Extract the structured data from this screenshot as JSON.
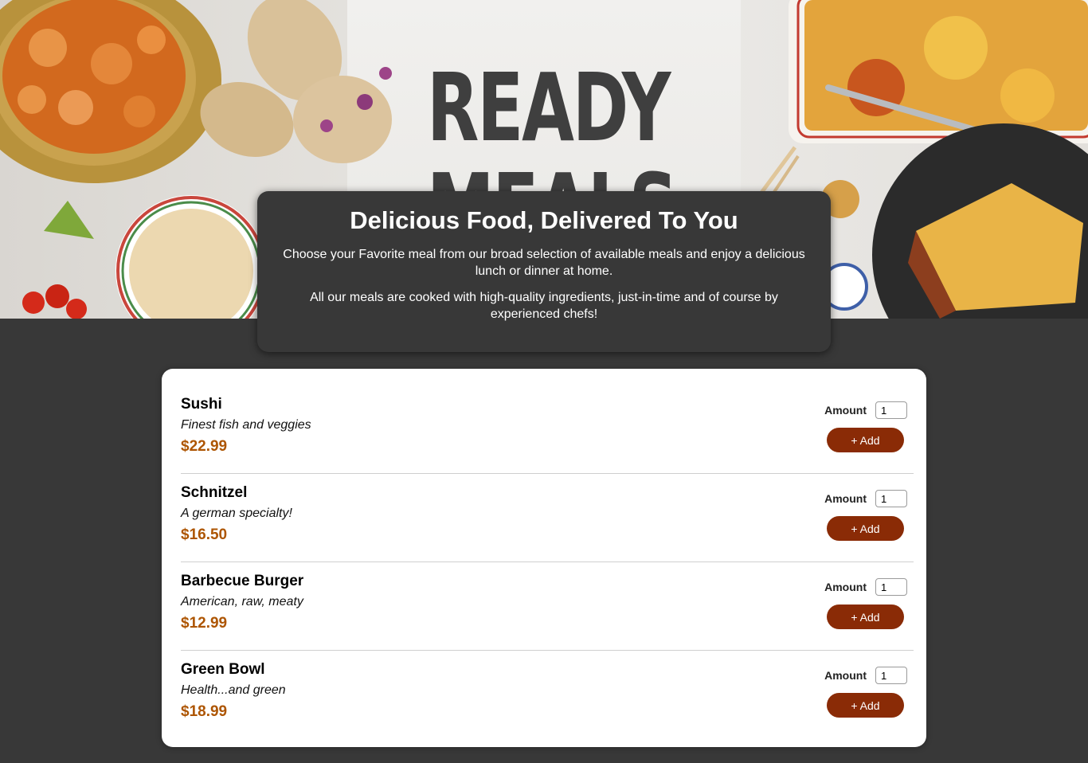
{
  "hero": {
    "headline_line1": "READY",
    "headline_line2": "MEALS"
  },
  "summary": {
    "title": "Delicious Food, Delivered To You",
    "paragraph1": "Choose your Favorite meal from our broad selection of available meals and enjoy a delicious lunch or dinner at home.",
    "paragraph2": "All our meals are cooked with high-quality ingredients, just-in-time and of course by experienced chefs!"
  },
  "form": {
    "amount_label": "Amount",
    "add_label": "+ Add"
  },
  "meals": [
    {
      "name": "Sushi",
      "description": "Finest fish and veggies",
      "price": "$22.99",
      "amount": "1"
    },
    {
      "name": "Schnitzel",
      "description": "A german specialty!",
      "price": "$16.50",
      "amount": "1"
    },
    {
      "name": "Barbecue Burger",
      "description": "American, raw, meaty",
      "price": "$12.99",
      "amount": "1"
    },
    {
      "name": "Green Bowl",
      "description": "Health...and green",
      "price": "$18.99",
      "amount": "1"
    }
  ],
  "colors": {
    "background": "#383838",
    "price": "#ad5502",
    "button": "#8a2b06"
  }
}
